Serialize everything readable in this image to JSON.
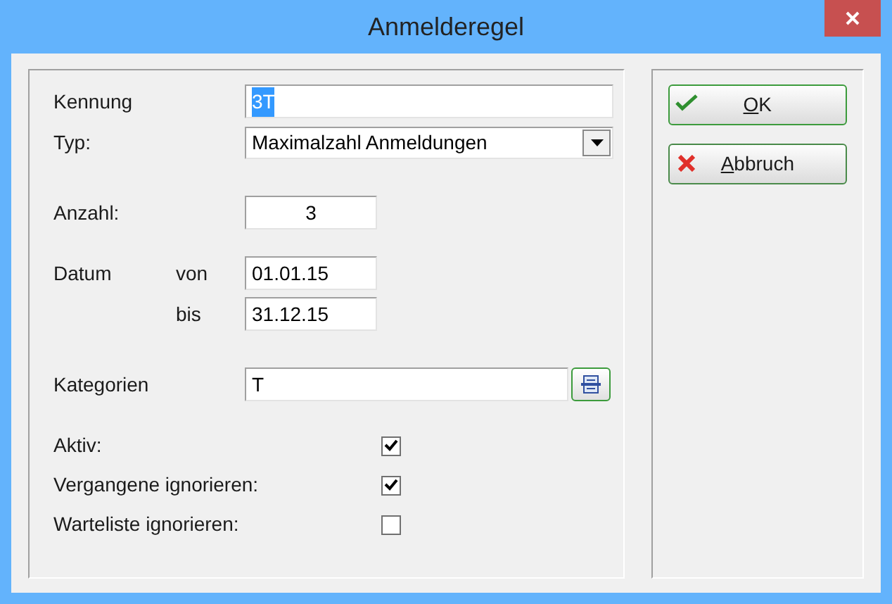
{
  "window": {
    "title": "Anmelderegel"
  },
  "kennung": {
    "label": "Kennung",
    "value": "3T",
    "selected": true
  },
  "typ": {
    "label": "Typ:",
    "value": "Maximalzahl Anmeldungen"
  },
  "anzahl": {
    "label": "Anzahl:",
    "value": "3"
  },
  "datum": {
    "label": "Datum",
    "from_label": "von",
    "from_value": "01.01.15",
    "to_label": "bis",
    "to_value": "31.12.15"
  },
  "kategorien": {
    "label": "Kategorien",
    "value": "T"
  },
  "checks": [
    {
      "label": "Aktiv:",
      "checked": true
    },
    {
      "label": "Vergangene ignorieren:",
      "checked": true
    },
    {
      "label": "Warteliste ignorieren:",
      "checked": false
    }
  ],
  "buttons": [
    {
      "kind": "ok",
      "label": "OK",
      "mnemonic": true
    },
    {
      "kind": "cancel",
      "label": "Abbruch",
      "mnemonic": true
    }
  ]
}
